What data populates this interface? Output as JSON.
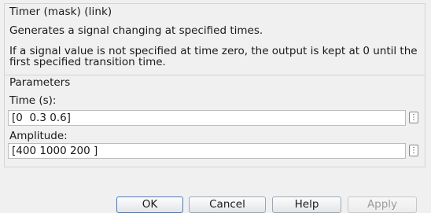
{
  "block": {
    "title": "Timer (mask) (link)",
    "description_line1": "Generates a signal changing at specified times.",
    "description_line2": "If a signal value is not specified at time zero, the output is kept at 0 until the first specified transition time."
  },
  "parameters": {
    "title": "Parameters",
    "time": {
      "label": "Time (s):",
      "value": "[0  0.3 0.6]"
    },
    "amplitude": {
      "label": "Amplitude:",
      "value": "[400 1000 200 ]"
    },
    "expand_glyph": "⋮"
  },
  "buttons": {
    "ok": "OK",
    "cancel": "Cancel",
    "help": "Help",
    "apply": "Apply",
    "apply_enabled": false
  }
}
